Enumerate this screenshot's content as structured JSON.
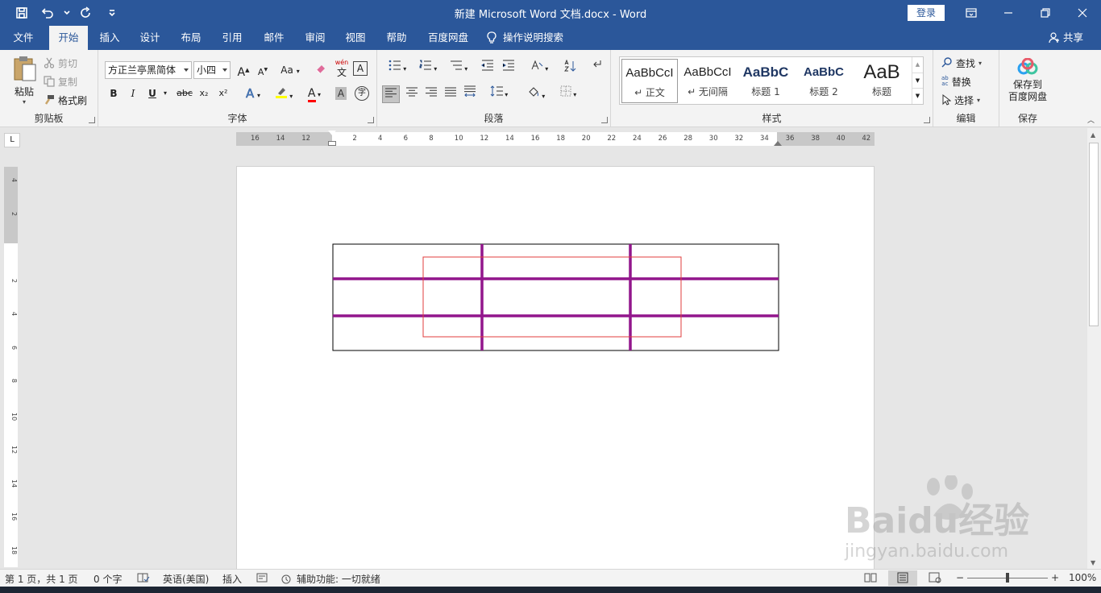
{
  "titlebar": {
    "title": "新建 Microsoft Word 文档.docx  -  Word",
    "login": "登录"
  },
  "tabs": [
    "文件",
    "开始",
    "插入",
    "设计",
    "布局",
    "引用",
    "邮件",
    "审阅",
    "视图",
    "帮助",
    "百度网盘",
    "操作说明搜索"
  ],
  "active_tab": "开始",
  "share": "共享",
  "clipboard": {
    "paste": "粘贴",
    "cut": "剪切",
    "copy": "复制",
    "format_painter": "格式刷",
    "label": "剪贴板"
  },
  "font": {
    "name": "方正兰亭黑简体",
    "size": "小四",
    "label": "字体",
    "aa": "Aa",
    "wen": "wén",
    "wen_char": "文",
    "a_box": "A",
    "bold": "B",
    "italic": "I",
    "underline": "U",
    "strike": "abc",
    "sub": "x₂",
    "sup": "x²",
    "a": "A",
    "zi": "字"
  },
  "paragraph": {
    "label": "段落"
  },
  "styles": {
    "label": "样式",
    "items": [
      {
        "preview": "AaBbCcI",
        "name": "↵ 正文"
      },
      {
        "preview": "AaBbCcI",
        "name": "↵ 无间隔"
      },
      {
        "preview": "AaBbC",
        "name": "标题 1"
      },
      {
        "preview": "AaBbC",
        "name": "标题 2"
      },
      {
        "preview": "AaB",
        "name": "标题"
      }
    ]
  },
  "editing": {
    "find": "查找",
    "replace": "替换",
    "select": "选择",
    "label": "编辑",
    "ab": "ab",
    "ac": "ac"
  },
  "save": {
    "button_line1": "保存到",
    "button_line2": "百度网盘",
    "label": "保存"
  },
  "ruler": {
    "corner": "L",
    "h_labels": [
      "16",
      "14",
      "12",
      "",
      "2",
      "4",
      "6",
      "8",
      "10",
      "12",
      "14",
      "16",
      "18",
      "20",
      "22",
      "24",
      "26",
      "28",
      "30",
      "32",
      "34",
      "36",
      "38",
      "40",
      "42"
    ],
    "v_labels": [
      "4",
      "2",
      "",
      "2",
      "4",
      "6",
      "8",
      "10",
      "12",
      "14",
      "16",
      "18"
    ]
  },
  "status": {
    "page": "第 1 页，共 1 页",
    "words": "0 个字",
    "lang": "英语(美国)",
    "mode": "插入",
    "accessibility": "辅助功能: 一切就绪",
    "zoom": "100%",
    "zoom_level": 1.0,
    "minus": "−",
    "plus": "+"
  },
  "table": {
    "rows": 3,
    "cols": 3,
    "border_color": "#000000",
    "inner_line_color": "#92168c",
    "shape_border_color": "#e03c3c"
  },
  "watermark": {
    "line1": "Baidu经验",
    "line2": "jingyan.baidu.com"
  },
  "colors": {
    "accent": "#2b579a",
    "ribbon_bg": "#f3f3f3",
    "highlight": "#ffff00",
    "font_color": "#ff0000"
  }
}
